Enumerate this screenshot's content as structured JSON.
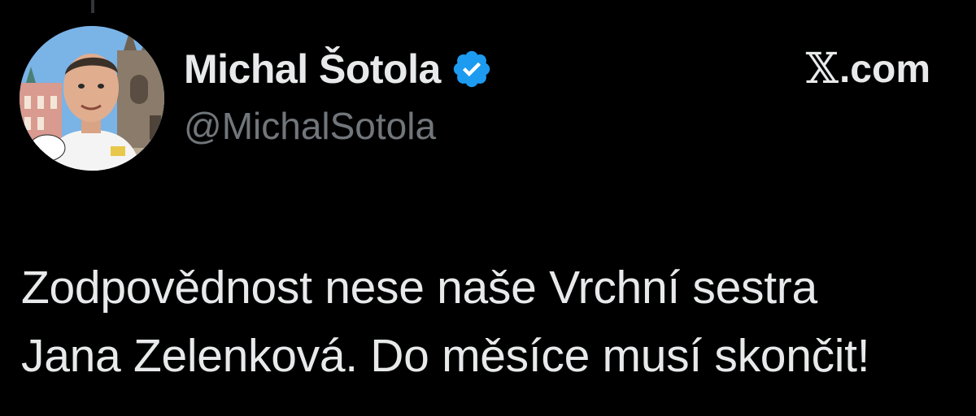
{
  "tweet": {
    "author": {
      "display_name": "Michal Šotola",
      "handle": "@MichalSotola",
      "verified": true,
      "verified_color": "#1d9bf0",
      "avatar_icon": "profile-photo"
    },
    "brand": {
      "glyph": "𝕏",
      "suffix": ".com"
    },
    "text_lines": [
      "Zodpovědnost nese naše Vrchní sestra",
      "Jana Zelenková. Do měsíce musí skončit!"
    ]
  },
  "theme": {
    "background": "#000000",
    "text": "#e7e9ea",
    "muted": "#71767b"
  }
}
